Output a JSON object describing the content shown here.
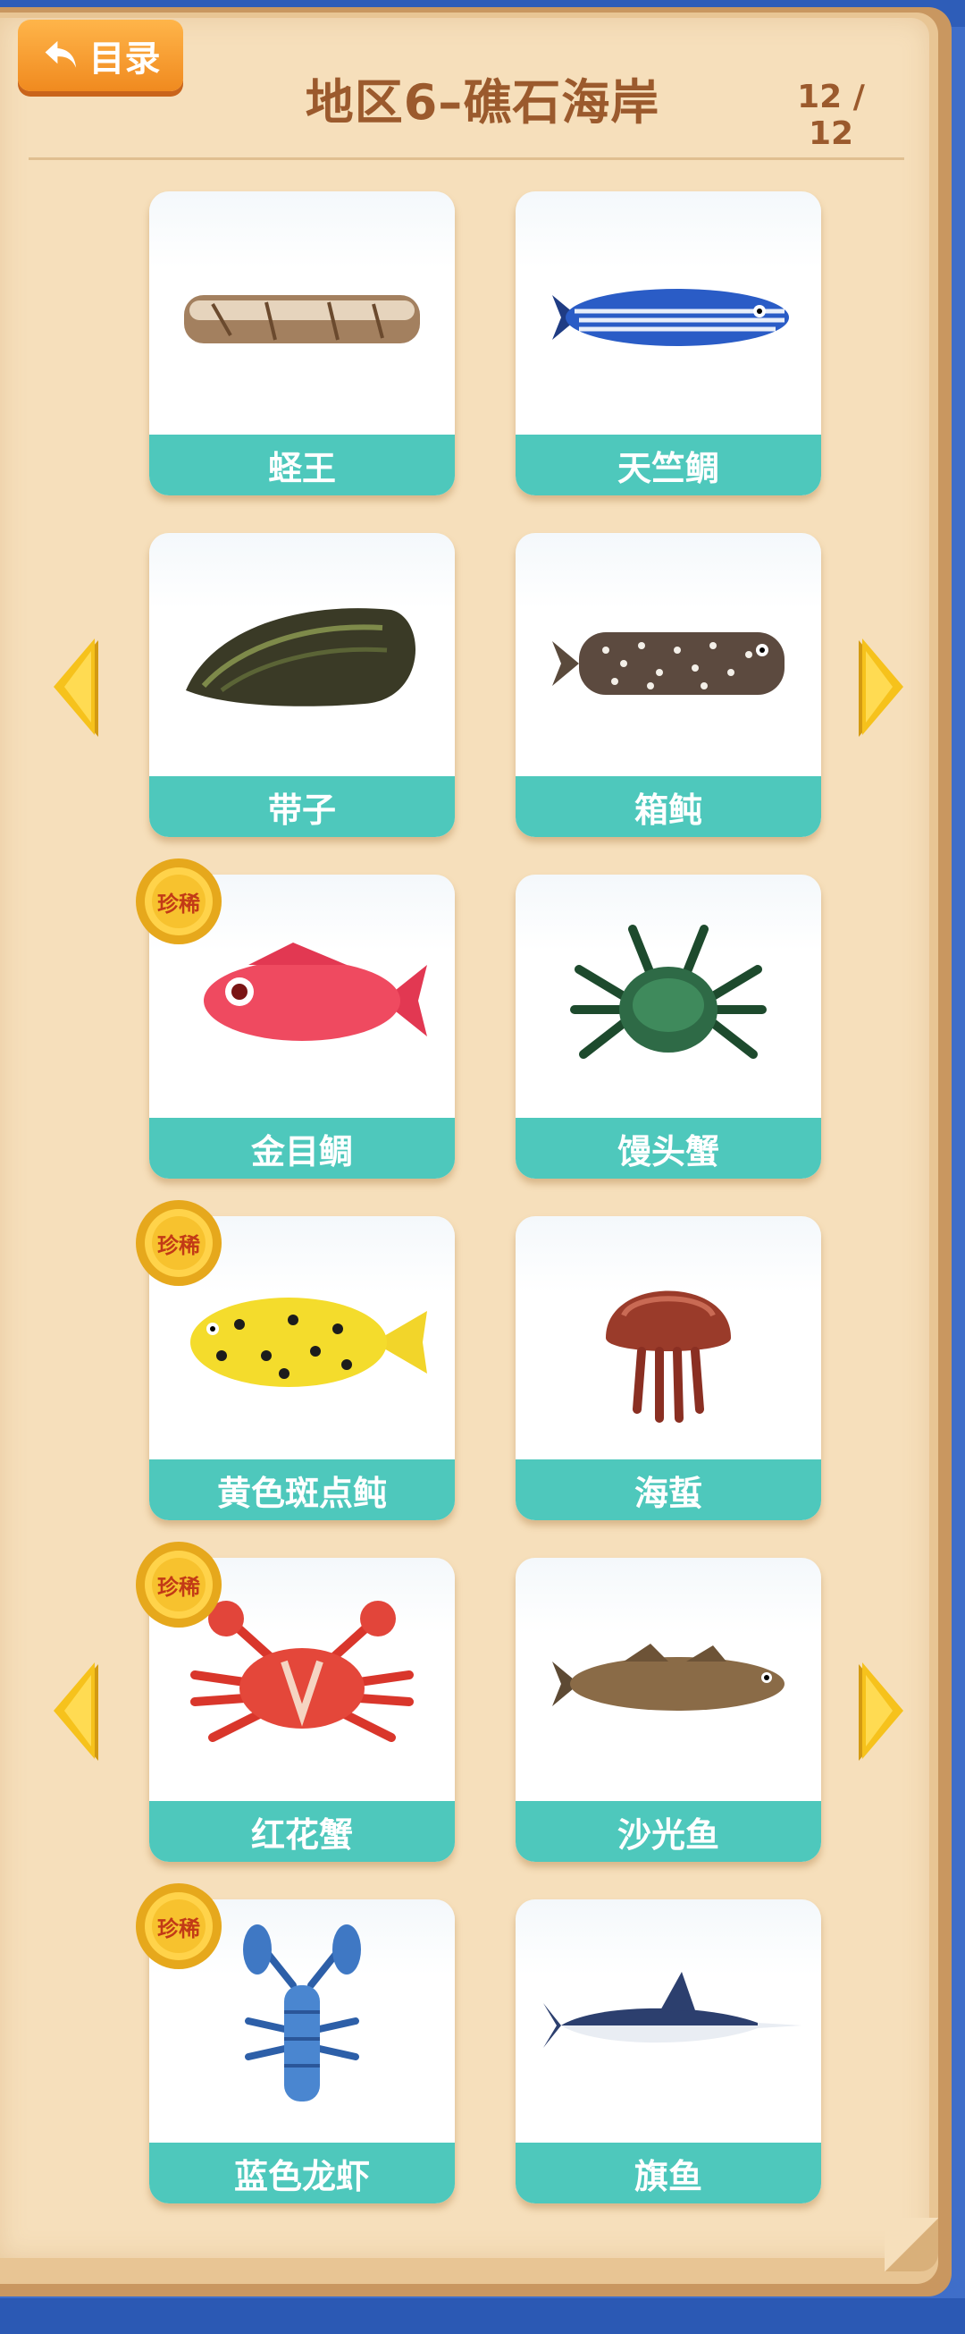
{
  "header": {
    "menu_label": "目录",
    "title": "地区6–礁石海岸",
    "page_indicator": "12 / 12"
  },
  "rare_badge_label": "珍稀",
  "cards": [
    {
      "name": "蛏王",
      "rare": false,
      "icon": "razor-clam-icon"
    },
    {
      "name": "天竺鲷",
      "rare": false,
      "icon": "cardinalfish-icon"
    },
    {
      "name": "带子",
      "rare": false,
      "icon": "mussel-icon"
    },
    {
      "name": "箱鲀",
      "rare": false,
      "icon": "boxfish-icon"
    },
    {
      "name": "金目鲷",
      "rare": true,
      "icon": "red-fish-icon"
    },
    {
      "name": "馒头蟹",
      "rare": false,
      "icon": "green-crab-icon"
    },
    {
      "name": "黄色斑点鲀",
      "rare": true,
      "icon": "yellow-puffer-icon"
    },
    {
      "name": "海蜇",
      "rare": false,
      "icon": "jellyfish-icon"
    },
    {
      "name": "红花蟹",
      "rare": true,
      "icon": "red-crab-icon"
    },
    {
      "name": "沙光鱼",
      "rare": false,
      "icon": "brown-fish-icon"
    },
    {
      "name": "蓝色龙虾",
      "rare": true,
      "icon": "blue-lobster-icon"
    },
    {
      "name": "旗鱼",
      "rare": false,
      "icon": "swordfish-icon"
    }
  ],
  "colors": {
    "label_bg": "#4ec8bc",
    "title": "#9b5a2d",
    "page": "#f6dfbb",
    "menu_button": "#f59a2f",
    "arrow": "#f6c21c"
  }
}
